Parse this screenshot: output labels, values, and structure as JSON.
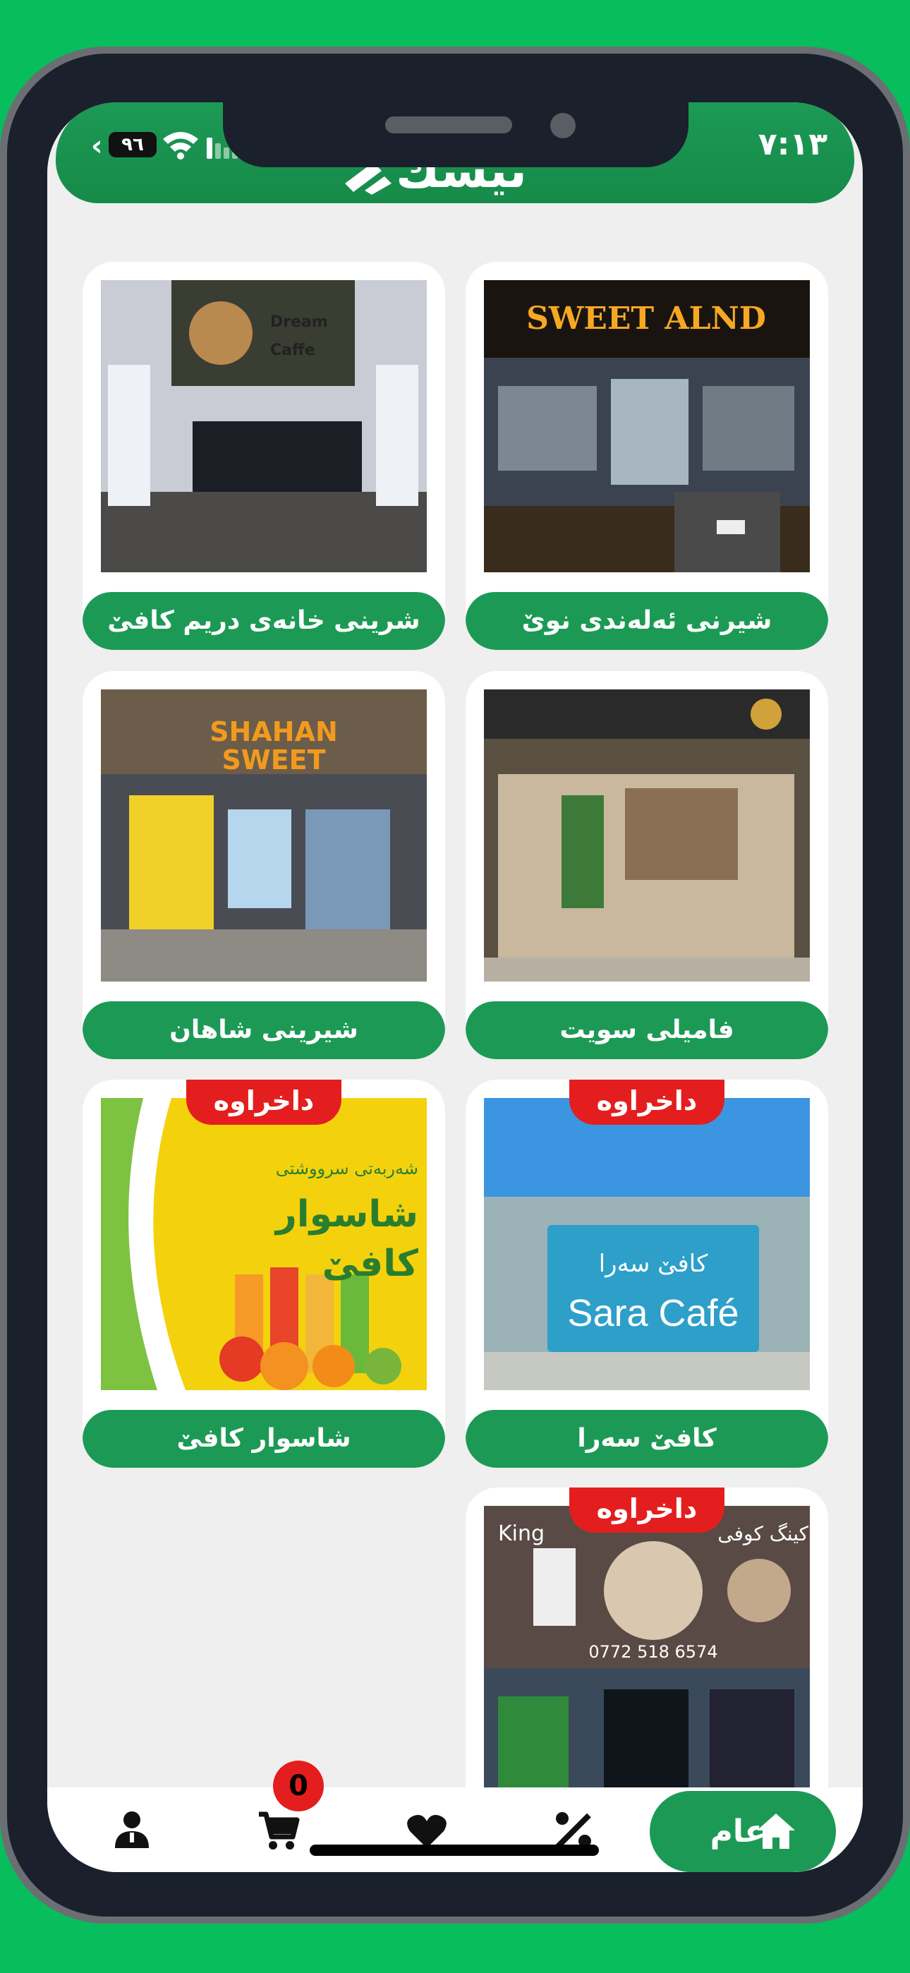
{
  "status_bar": {
    "time": "٧:١٣",
    "battery": "٩٦"
  },
  "header": {
    "logo_text": "تيسك"
  },
  "colors": {
    "brand_green": "#1c9a55",
    "badge_red": "#e41e1e",
    "outer_background": "#08bd5c"
  },
  "cards": [
    {
      "name": "شيرنى ئەلەندى نوێ",
      "badge": "",
      "sign_text": "SWEET ALND"
    },
    {
      "name": "شرينى خانەى دريم كافێ",
      "badge": "",
      "sign_text": "Dream Caffe"
    },
    {
      "name": "فاميلى سويت",
      "badge": "",
      "sign_text": ""
    },
    {
      "name": "شيرينى شاهان",
      "badge": "",
      "sign_text": "SHAHAN SWEET"
    },
    {
      "name": "كافێ سەرا",
      "badge": "داخراوە",
      "sign_text": "Sara Café",
      "sign_text_2": "كافێ سەرا"
    },
    {
      "name": "شاسوار كافێ",
      "badge": "داخراوە",
      "sign_text": "شاسوار كافێ",
      "sign_text_2": "شەربەتى سرووشتى"
    },
    {
      "name": "",
      "badge": "داخراوە",
      "sign_text": "King",
      "sign_text_2": "كينگ كوفى",
      "sign_phone": "0772 518 6574"
    }
  ],
  "bottom_nav": {
    "home_label": "عام",
    "cart_count": "0",
    "icons": [
      "home-icon",
      "percent-icon",
      "heart-icon",
      "cart-icon",
      "user-icon"
    ]
  }
}
